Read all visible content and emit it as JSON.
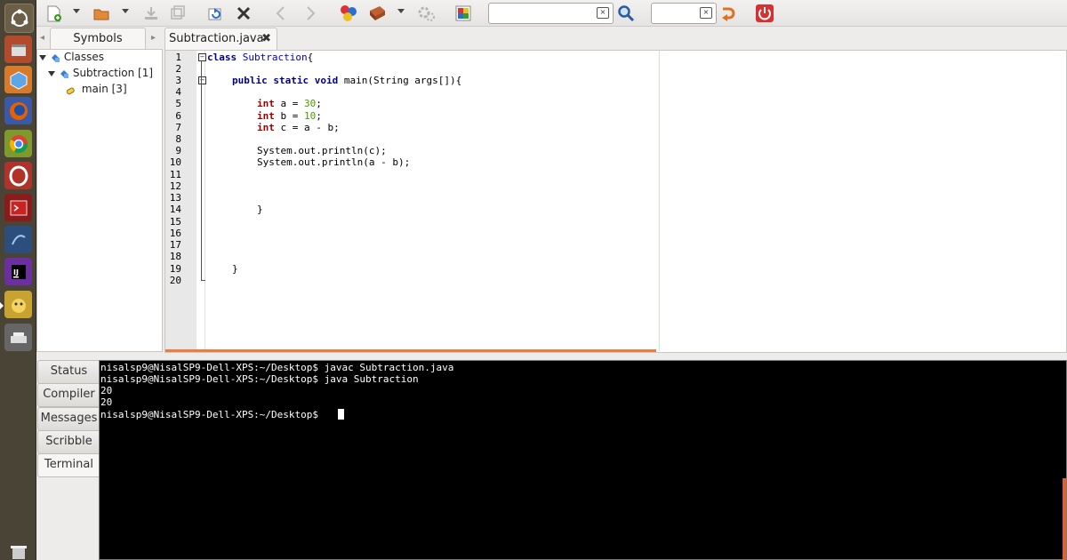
{
  "toolbar": {
    "search_value": "",
    "goto_value": ""
  },
  "symbols": {
    "tab_label": "Symbols",
    "tree": [
      {
        "label": "Classes"
      },
      {
        "label": "Subtraction [1]"
      },
      {
        "label": "main [3]"
      }
    ]
  },
  "editor": {
    "tab_label": "Subtraction.java",
    "line_numbers": [
      "1",
      "2",
      "3",
      "4",
      "5",
      "6",
      "7",
      "8",
      "9",
      "10",
      "11",
      "12",
      "13",
      "14",
      "15",
      "16",
      "17",
      "18",
      "19",
      "20"
    ],
    "code": {
      "l1_kw": "class",
      "l1_name": "Subtraction",
      "l1_brace": "{",
      "l3_kw": "public static void",
      "l3_rest": " main(String args[]){",
      "l5_type": "int",
      "l5_var": " a = ",
      "l5_num": "30",
      "l5_end": ";",
      "l6_type": "int",
      "l6_var": " b = ",
      "l6_num": "10",
      "l6_end": ";",
      "l7_type": "int",
      "l7_rest": " c = a - b;",
      "l9": "System.out.println(c);",
      "l10": "System.out.println(a - b);",
      "l14": "}",
      "l19": "}"
    }
  },
  "bottom_tabs": [
    "Status",
    "Compiler",
    "Messages",
    "Scribble",
    "Terminal"
  ],
  "terminal": {
    "lines": [
      "nisalsp9@NisalSP9-Dell-XPS:~/Desktop$ javac Subtraction.java",
      "nisalsp9@NisalSP9-Dell-XPS:~/Desktop$ java Subtraction",
      "20",
      "20",
      "nisalsp9@NisalSP9-Dell-XPS:~/Desktop$ "
    ]
  },
  "launcher": {
    "items": [
      "ubuntu-dash-icon",
      "files-icon",
      "software-center-icon",
      "firefox-icon",
      "chrome-icon",
      "opera-icon",
      "terminal-app-icon",
      "mysql-workbench-icon",
      "intellij-icon",
      "geany-icon",
      "scanner-icon",
      "trash-icon"
    ]
  },
  "colors": {
    "accent": "#f07b3f",
    "keyword": "#00008b",
    "type": "#9b0000",
    "number": "#4c9a00",
    "terminal_bg": "#000000"
  }
}
